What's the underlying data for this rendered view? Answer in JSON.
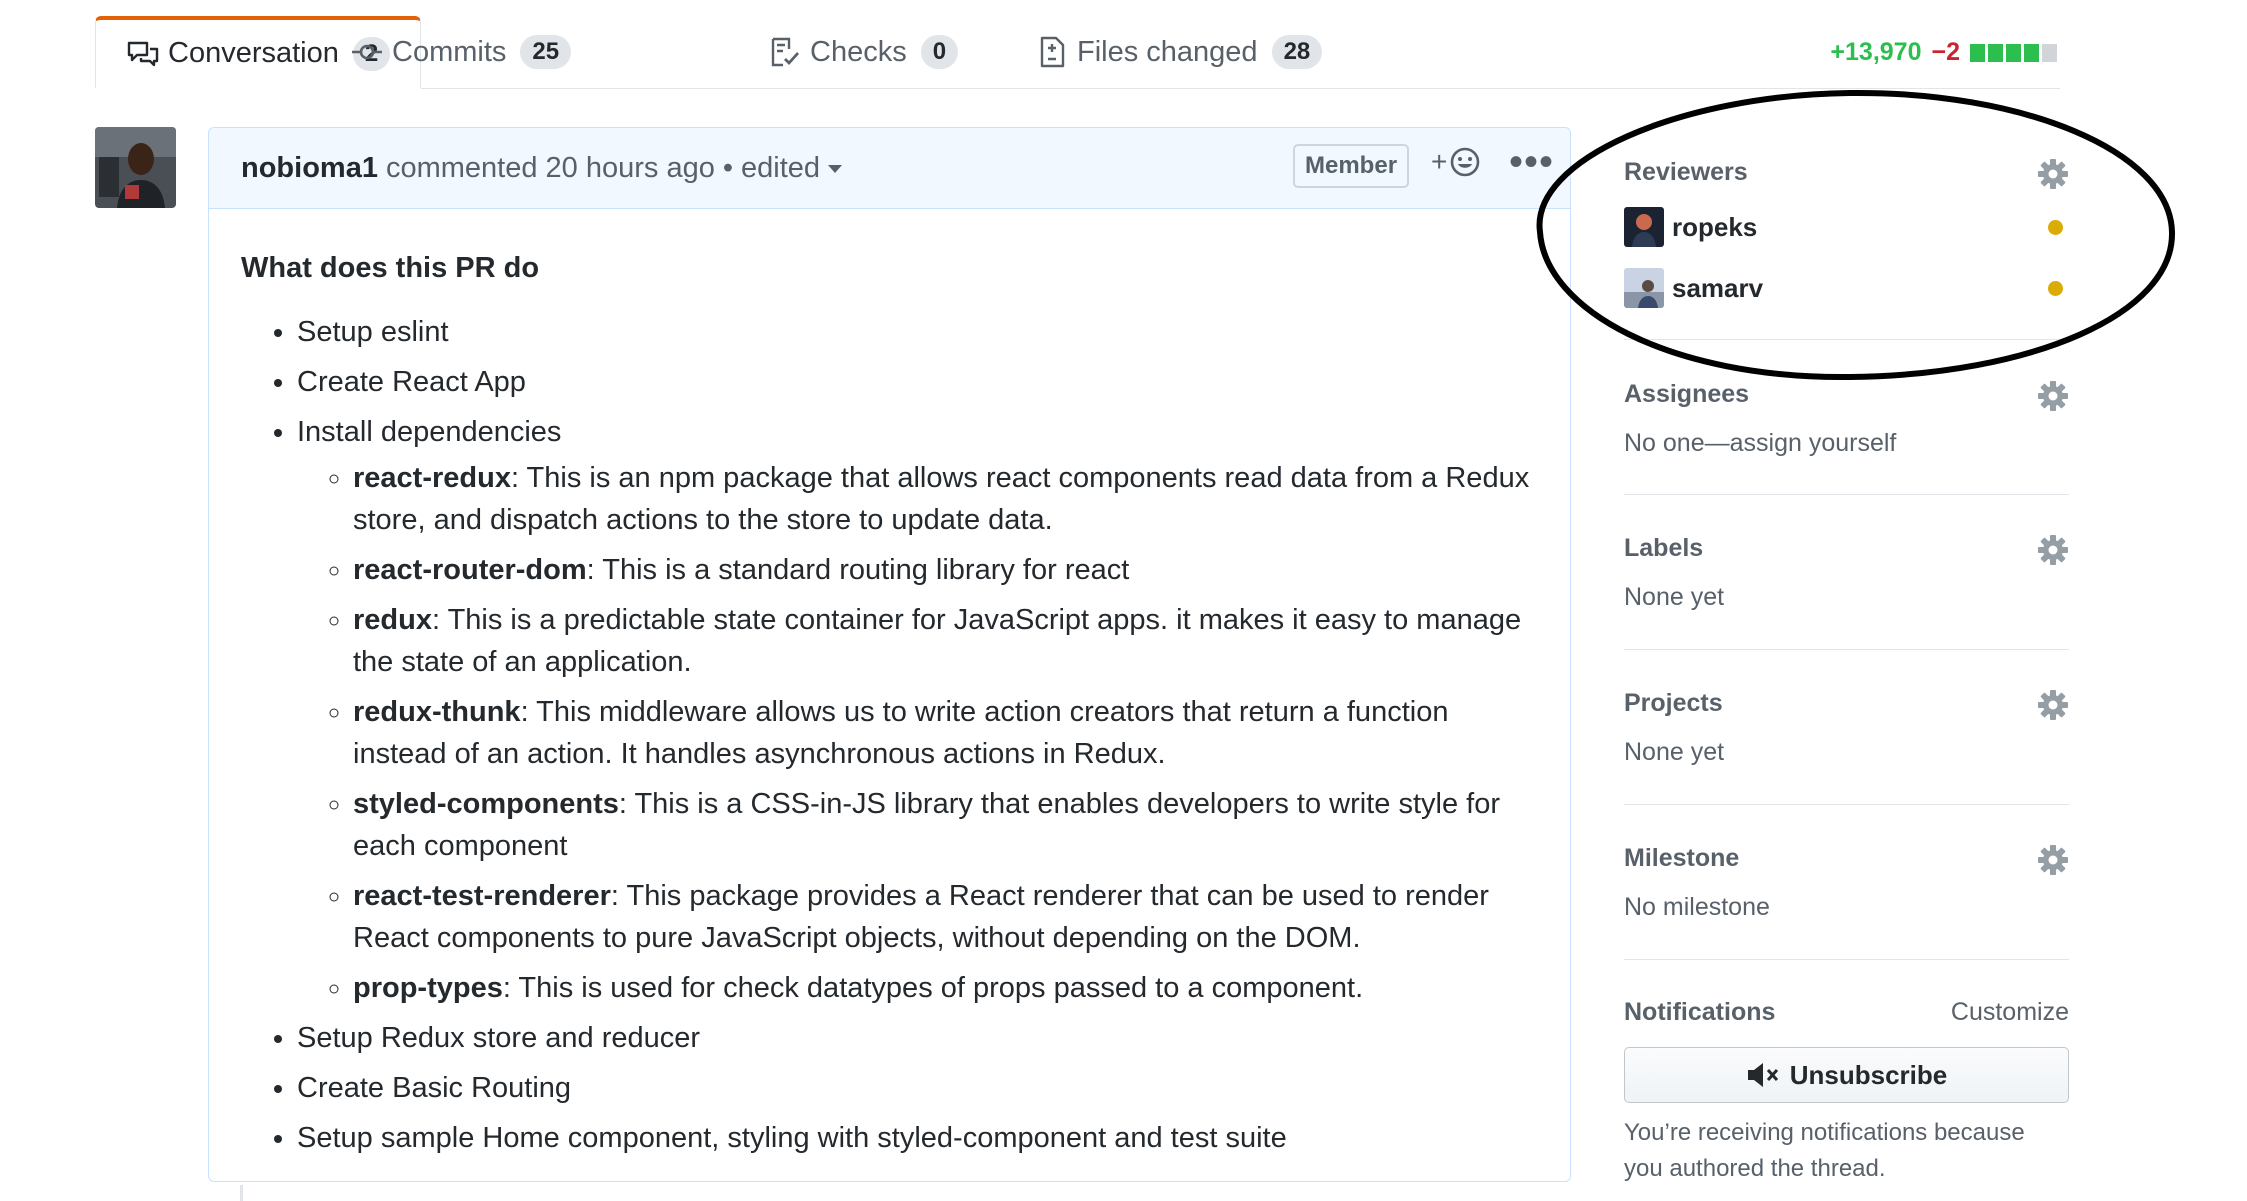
{
  "tabs": [
    {
      "label": "Conversation",
      "count": "2",
      "icon": "comment-discussion-icon"
    },
    {
      "label": "Commits",
      "count": "25",
      "icon": "git-commit-icon"
    },
    {
      "label": "Checks",
      "count": "0",
      "icon": "checklist-icon"
    },
    {
      "label": "Files changed",
      "count": "28",
      "icon": "file-diff-icon"
    }
  ],
  "diffstat": {
    "additions": "+13,970",
    "deletions": "−2",
    "colors": {
      "add": "#2cbe4e",
      "del": "#cb2431",
      "neutral": "#d1d5da"
    }
  },
  "comment": {
    "author": "nobioma1",
    "action": "commented 20 hours ago",
    "separator": "•",
    "edited": "edited",
    "role_badge": "Member",
    "reaction_label": "+",
    "more_label": "•••",
    "heading": "What does this PR do",
    "items_before": [
      "Setup eslint",
      "Create React App",
      "Install dependencies"
    ],
    "dependencies": [
      {
        "name": "react-redux",
        "desc": ": This is an npm package that allows react components read data from a Redux store, and dispatch actions to the store to update data."
      },
      {
        "name": "react-router-dom",
        "desc": ": This is a standard routing library for react"
      },
      {
        "name": "redux",
        "desc": ": This is a predictable state container for JavaScript apps. it makes it easy to manage the state of an application."
      },
      {
        "name": "redux-thunk",
        "desc": ": This middleware allows us to write action creators that return a function instead of an action. It handles asynchronous actions in Redux."
      },
      {
        "name": "styled-components",
        "desc": ": This is a CSS-in-JS library that enables developers to write style for each component"
      },
      {
        "name": "react-test-renderer",
        "desc": ": This package provides a React renderer that can be used to render React components to pure JavaScript objects, without depending on the DOM."
      },
      {
        "name": "prop-types",
        "desc": ": This is used for check datatypes of props passed to a component."
      }
    ],
    "items_after": [
      "Setup Redux store and reducer",
      "Create Basic Routing",
      "Setup sample Home component, styling with styled-component and test suite"
    ]
  },
  "sidebar": {
    "reviewers": {
      "heading": "Reviewers",
      "people": [
        {
          "name": "ropeks",
          "status_color": "#dbab09"
        },
        {
          "name": "samarv",
          "status_color": "#dbab09"
        }
      ]
    },
    "assignees": {
      "heading": "Assignees",
      "text": "No one—assign yourself"
    },
    "labels": {
      "heading": "Labels",
      "text": "None yet"
    },
    "projects": {
      "heading": "Projects",
      "text": "None yet"
    },
    "milestone": {
      "heading": "Milestone",
      "text": "No milestone"
    },
    "notifications": {
      "heading": "Notifications",
      "customize": "Customize",
      "button": "Unsubscribe",
      "note": "You’re receiving notifications because you authored the thread."
    }
  },
  "accent_colors": {
    "tab_selected_border": "#e36209",
    "comment_border": "#c8e1ff",
    "comment_header_bg": "#f1f8ff"
  }
}
